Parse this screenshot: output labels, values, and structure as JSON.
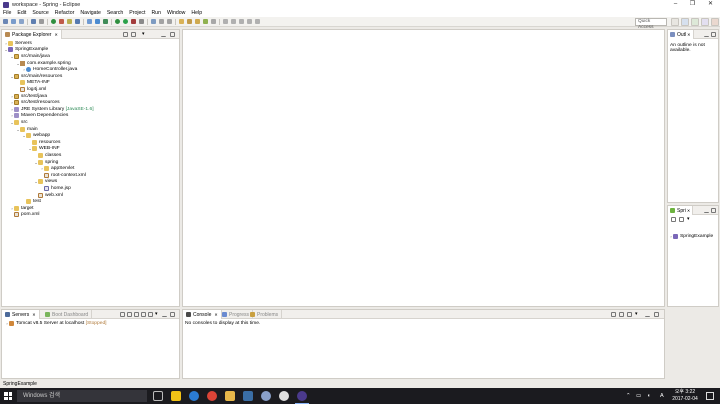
{
  "window": {
    "title": "workspace - Spring - Eclipse"
  },
  "menu": [
    "File",
    "Edit",
    "Source",
    "Refactor",
    "Navigate",
    "Search",
    "Project",
    "Run",
    "Window",
    "Help"
  ],
  "toolbar": {
    "quick_access": "Quick Access"
  },
  "package_explorer": {
    "tab_label": "Package Explorer",
    "tree": [
      {
        "label": "Servers"
      },
      {
        "label": "SpringExample"
      },
      {
        "label": "src/main/java"
      },
      {
        "label": "com.example.spring"
      },
      {
        "label": "HomeController.java"
      },
      {
        "label": "src/main/resources"
      },
      {
        "label": "META-INF"
      },
      {
        "label": "log4j.xml"
      },
      {
        "label": "src/test/java"
      },
      {
        "label": "src/test/resources"
      },
      {
        "label": "JRE System Library",
        "suffix": "[JavaSE-1.6]"
      },
      {
        "label": "Maven Dependencies"
      },
      {
        "label": "src"
      },
      {
        "label": "main"
      },
      {
        "label": "webapp"
      },
      {
        "label": "resources"
      },
      {
        "label": "WEB-INF"
      },
      {
        "label": "classes"
      },
      {
        "label": "spring"
      },
      {
        "label": "appServlet"
      },
      {
        "label": "root-context.xml"
      },
      {
        "label": "views"
      },
      {
        "label": "home.jsp"
      },
      {
        "label": "web.xml"
      },
      {
        "label": "test"
      },
      {
        "label": "target"
      },
      {
        "label": "pom.xml"
      }
    ]
  },
  "outline": {
    "tab_label": "Outl",
    "message": "An outline is not available."
  },
  "spring": {
    "tab_label": "Spri",
    "item": "SpringExample"
  },
  "servers": {
    "tabs": [
      "Servers",
      "Boot Dashboard"
    ],
    "row": {
      "label": "Tomcat v8.5 Server at localhost",
      "state": "[Stopped]"
    }
  },
  "console": {
    "tabs": [
      "Console",
      "Progress",
      "Problems"
    ],
    "message": "No consoles to display at this time."
  },
  "status": {
    "text": "SpringExample"
  },
  "taskbar": {
    "search_placeholder": "Windows 검색",
    "clock_time": "오후 3:22",
    "clock_date": "2017-02-04",
    "lang": "A"
  },
  "colors": {
    "accent": "#1a5fb4",
    "taskbar": "#1b1b1f",
    "panel_tab": "#f1efec"
  }
}
